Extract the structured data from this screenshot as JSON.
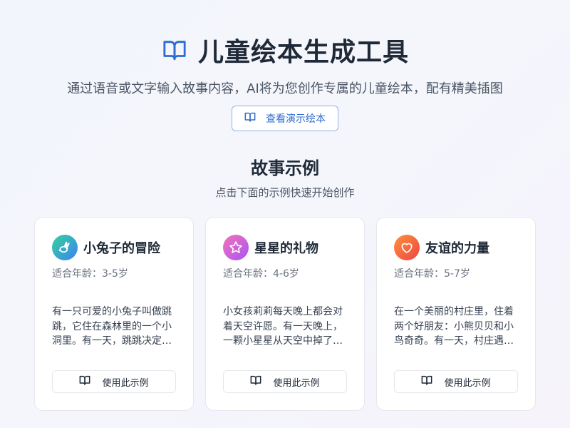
{
  "header": {
    "title": "儿童绘本生成工具",
    "subtitle": "通过语音或文字输入故事内容，AI将为您创作专属的儿童绘本，配有精美插图",
    "demo_button": "查看演示绘本",
    "icon": "book-open-icon"
  },
  "examples": {
    "title": "故事示例",
    "subtitle": "点击下面的示例快速开始创作",
    "cards": [
      {
        "title": "小兔子的冒险",
        "age": "适合年龄：3-5岁",
        "description": "有一只可爱的小兔子叫做跳跳，它住在森林里的一个小洞里。有一天，跳跳决定去探索森林的另一边，寻找…",
        "button": "使用此示例",
        "icon": "rabbit-icon",
        "gradient": [
          "#34d399",
          "#3b82f6"
        ]
      },
      {
        "title": "星星的礼物",
        "age": "适合年龄：4-6岁",
        "description": "小女孩莉莉每天晚上都会对着天空许愿。有一天晚上，一颗小星星从天空中掉了下来，落在了她的花园里。…",
        "button": "使用此示例",
        "icon": "star-icon",
        "gradient": [
          "#f472b6",
          "#a855f7"
        ]
      },
      {
        "title": "友谊的力量",
        "age": "适合年龄：5-7岁",
        "description": "在一个美丽的村庄里，住着两个好朋友：小熊贝贝和小鸟奇奇。有一天，村庄遇到了大风暴，许多小动物的…",
        "button": "使用此示例",
        "icon": "heart-icon",
        "gradient": [
          "#fb923c",
          "#ef4444"
        ]
      }
    ]
  }
}
